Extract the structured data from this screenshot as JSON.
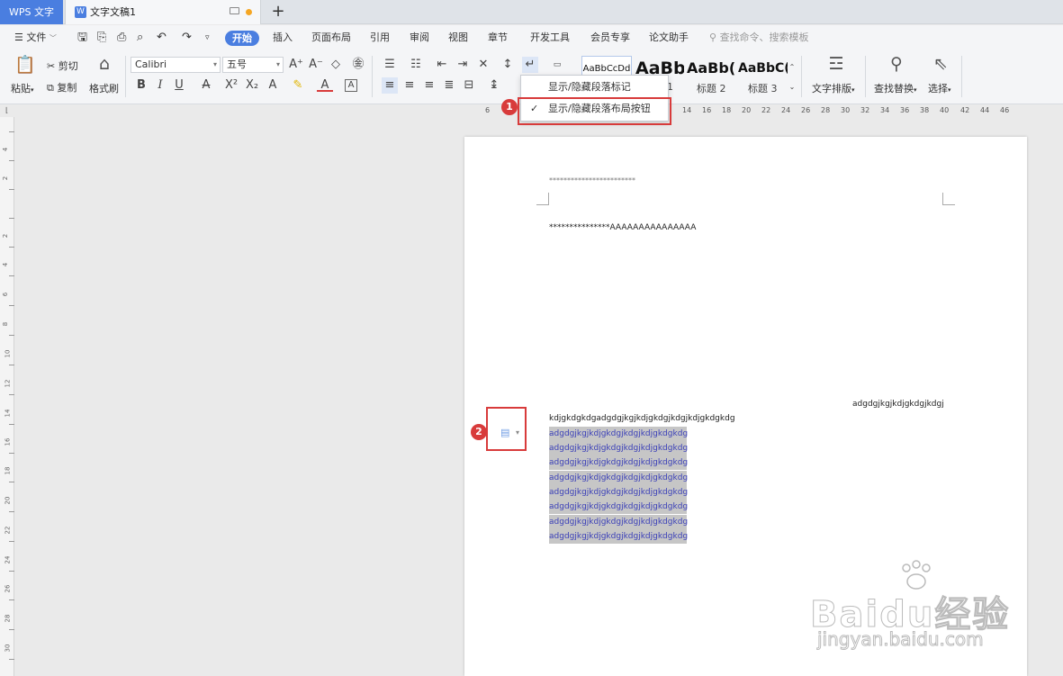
{
  "titlebar": {
    "app_tab": "WPS 文字",
    "doc_tab": "文字文稿1",
    "doc_tab_icon": "W"
  },
  "menubar": {
    "file": "文件",
    "items": [
      "开始",
      "插入",
      "页面布局",
      "引用",
      "审阅",
      "视图",
      "章节",
      "开发工具",
      "会员专享",
      "论文助手"
    ],
    "search_placeholder": "查找命令、搜索模板"
  },
  "ribbon": {
    "paste": "粘贴",
    "cut": "剪切",
    "copy": "复制",
    "format_painter": "格式刷",
    "font_name": "Calibri",
    "font_size": "五号",
    "styles": [
      {
        "preview": "AaBbCcDd",
        "label": ""
      },
      {
        "preview": "AaBb",
        "label": "1"
      },
      {
        "preview": "AaBb(",
        "label": "标题 2"
      },
      {
        "preview": "AaBbC(",
        "label": "标题 3"
      }
    ],
    "text_layout": "文字排版",
    "find_replace": "查找替换",
    "select": "选择"
  },
  "dropdown": {
    "items": [
      {
        "label": "显示/隐藏段落标记",
        "checked": false
      },
      {
        "label": "显示/隐藏段落布局按钮",
        "checked": true
      }
    ]
  },
  "badges": {
    "one": "1",
    "two": "2"
  },
  "ruler": {
    "ticks": [
      "6",
      "14",
      "16",
      "18",
      "20",
      "22",
      "24",
      "26",
      "28",
      "30",
      "32",
      "34",
      "36",
      "38",
      "40",
      "42",
      "44",
      "46"
    ]
  },
  "vruler": {
    "ticks": [
      "4",
      "2",
      "2",
      "4",
      "6",
      "8",
      "10",
      "12",
      "14",
      "16",
      "18",
      "20",
      "22",
      "24",
      "26",
      "28",
      "30"
    ]
  },
  "document": {
    "header_dots": "************************",
    "line1": "***************AAAAAAAAAAAAAAA",
    "right_line": "adgdgjkgjkdjgkdgjkdgj",
    "line2": "kdjgkdgkdgadgdgjkgjkdjgkdgjkdgjkdjgkdgkdg",
    "selected_lines": [
      "adgdgjkgjkdjgkdgjkdgjkdjgkdgkdg",
      "adgdgjkgjkdjgkdgjkdgjkdjgkdgkdg",
      "adgdgjkgjkdjgkdgjkdgjkdjgkdgkdg",
      "adgdgjkgjkdjgkdgjkdgjkdjgkdgkdg",
      "adgdgjkgjkdjgkdgjkdgjkdjgkdgkdg",
      "adgdgjkgjkdjgkdgjkdgjkdjgkdgkdg",
      "adgdgjkgjkdjgkdgjkdgjkdjgkdgkdg",
      "adgdgjkgjkdjgkdgjkdgjkdjgkdgkdg"
    ]
  },
  "watermark": {
    "main": "Bai",
    "main2": "du",
    "cn": "经验",
    "url": "jingyan.baidu.com"
  },
  "colors": {
    "accent": "#4a7ee0",
    "highlight_red": "#d83b3b",
    "selection_bg": "#c6c6c6",
    "selected_text": "#3a3fb8"
  }
}
